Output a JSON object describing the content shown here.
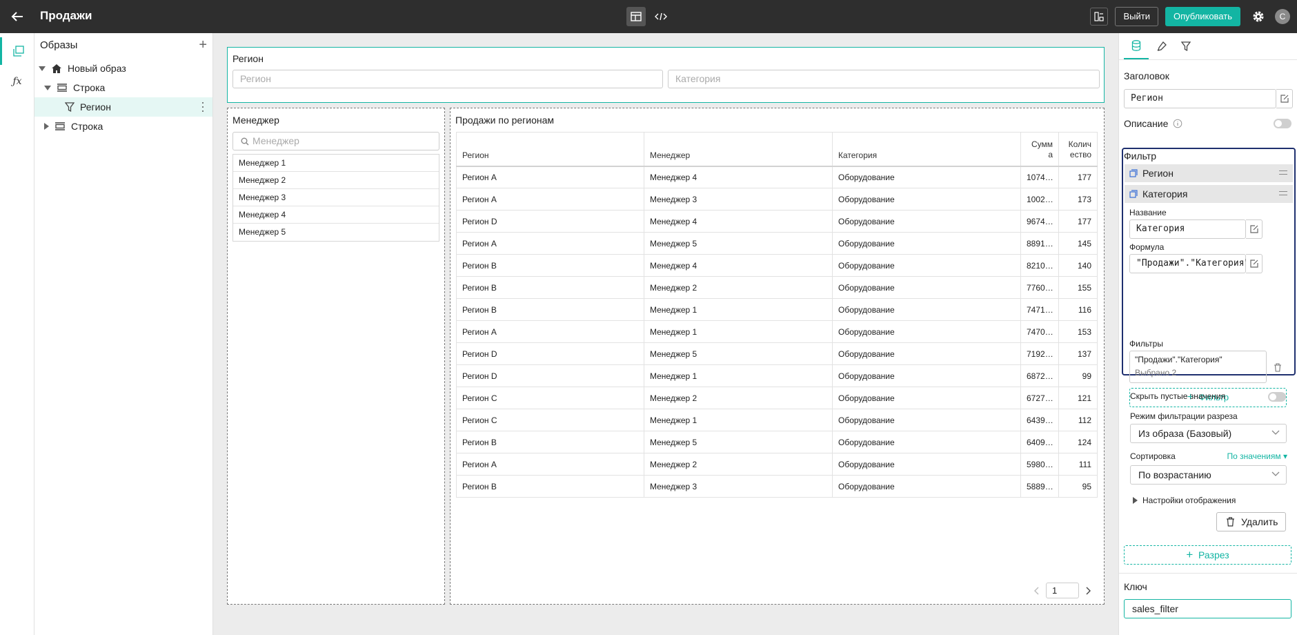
{
  "topbar": {
    "title": "Продажи",
    "exit_label": "Выйти",
    "publish_label": "Опубликовать",
    "avatar_letter": "С"
  },
  "tree": {
    "header": "Образы",
    "items": [
      {
        "label": "Новый образ"
      },
      {
        "label": "Строка"
      },
      {
        "label": "Регион"
      },
      {
        "label": "Строка"
      }
    ]
  },
  "region_panel": {
    "label": "Регион",
    "region_placeholder": "Регион",
    "category_placeholder": "Категория"
  },
  "manager_panel": {
    "label": "Менеджер",
    "search_placeholder": "Менеджер",
    "items": [
      "Менеджер 1",
      "Менеджер 2",
      "Менеджер 3",
      "Менеджер 4",
      "Менеджер 5"
    ]
  },
  "sales_panel": {
    "label": "Продажи по регионам",
    "columns": [
      "Регион",
      "Менеджер",
      "Категория",
      "Сумм а",
      "Колич ество"
    ],
    "rows": [
      [
        "Регион A",
        "Менеджер 4",
        "Оборудование",
        "1074…",
        "177"
      ],
      [
        "Регион A",
        "Менеджер 3",
        "Оборудование",
        "1002…",
        "173"
      ],
      [
        "Регион D",
        "Менеджер 4",
        "Оборудование",
        "9674…",
        "177"
      ],
      [
        "Регион A",
        "Менеджер 5",
        "Оборудование",
        "8891…",
        "145"
      ],
      [
        "Регион B",
        "Менеджер 4",
        "Оборудование",
        "8210…",
        "140"
      ],
      [
        "Регион B",
        "Менеджер 2",
        "Оборудование",
        "7760…",
        "155"
      ],
      [
        "Регион B",
        "Менеджер 1",
        "Оборудование",
        "7471…",
        "116"
      ],
      [
        "Регион A",
        "Менеджер 1",
        "Оборудование",
        "7470…",
        "153"
      ],
      [
        "Регион D",
        "Менеджер 5",
        "Оборудование",
        "7192…",
        "137"
      ],
      [
        "Регион D",
        "Менеджер 1",
        "Оборудование",
        "6872…",
        "99"
      ],
      [
        "Регион C",
        "Менеджер 2",
        "Оборудование",
        "6727…",
        "121"
      ],
      [
        "Регион C",
        "Менеджер 1",
        "Оборудование",
        "6439…",
        "112"
      ],
      [
        "Регион B",
        "Менеджер 5",
        "Оборудование",
        "6409…",
        "124"
      ],
      [
        "Регион A",
        "Менеджер 2",
        "Оборудование",
        "5980…",
        "111"
      ],
      [
        "Регион B",
        "Менеджер 3",
        "Оборудование",
        "5889…",
        "95"
      ]
    ],
    "page": "1"
  },
  "props": {
    "title_label": "Заголовок",
    "title_value": "Регион",
    "description_label": "Описание",
    "filter_section": "Фильтр",
    "filter_items": [
      "Регион",
      "Категория"
    ],
    "name_label": "Название",
    "name_value": "Категория",
    "formula_label": "Формула",
    "formula_value": "\"Продажи\".\"Категория\"",
    "filters_label": "Фильтры",
    "filters_value": "\"Продажи\".\"Категория\"",
    "filters_selected": "Выбрано 2",
    "add_filter_label": "Фильтр",
    "hide_empty_label": "Скрыть пустые значения",
    "filter_mode_label": "Режим фильтрации разреза",
    "filter_mode_value": "Из образа (Базовый)",
    "sort_label": "Сортировка",
    "sort_link": "По значениям",
    "sort_value": "По возрастанию",
    "display_settings": "Настройки отображения",
    "delete_label": "Удалить",
    "add_slice_label": "Разрез",
    "key_label": "Ключ",
    "key_value": "sales_filter"
  },
  "colors": {
    "accent": "#13b5a3",
    "topbar": "#2e2e2e",
    "selection_border": "#1e2f6e"
  }
}
